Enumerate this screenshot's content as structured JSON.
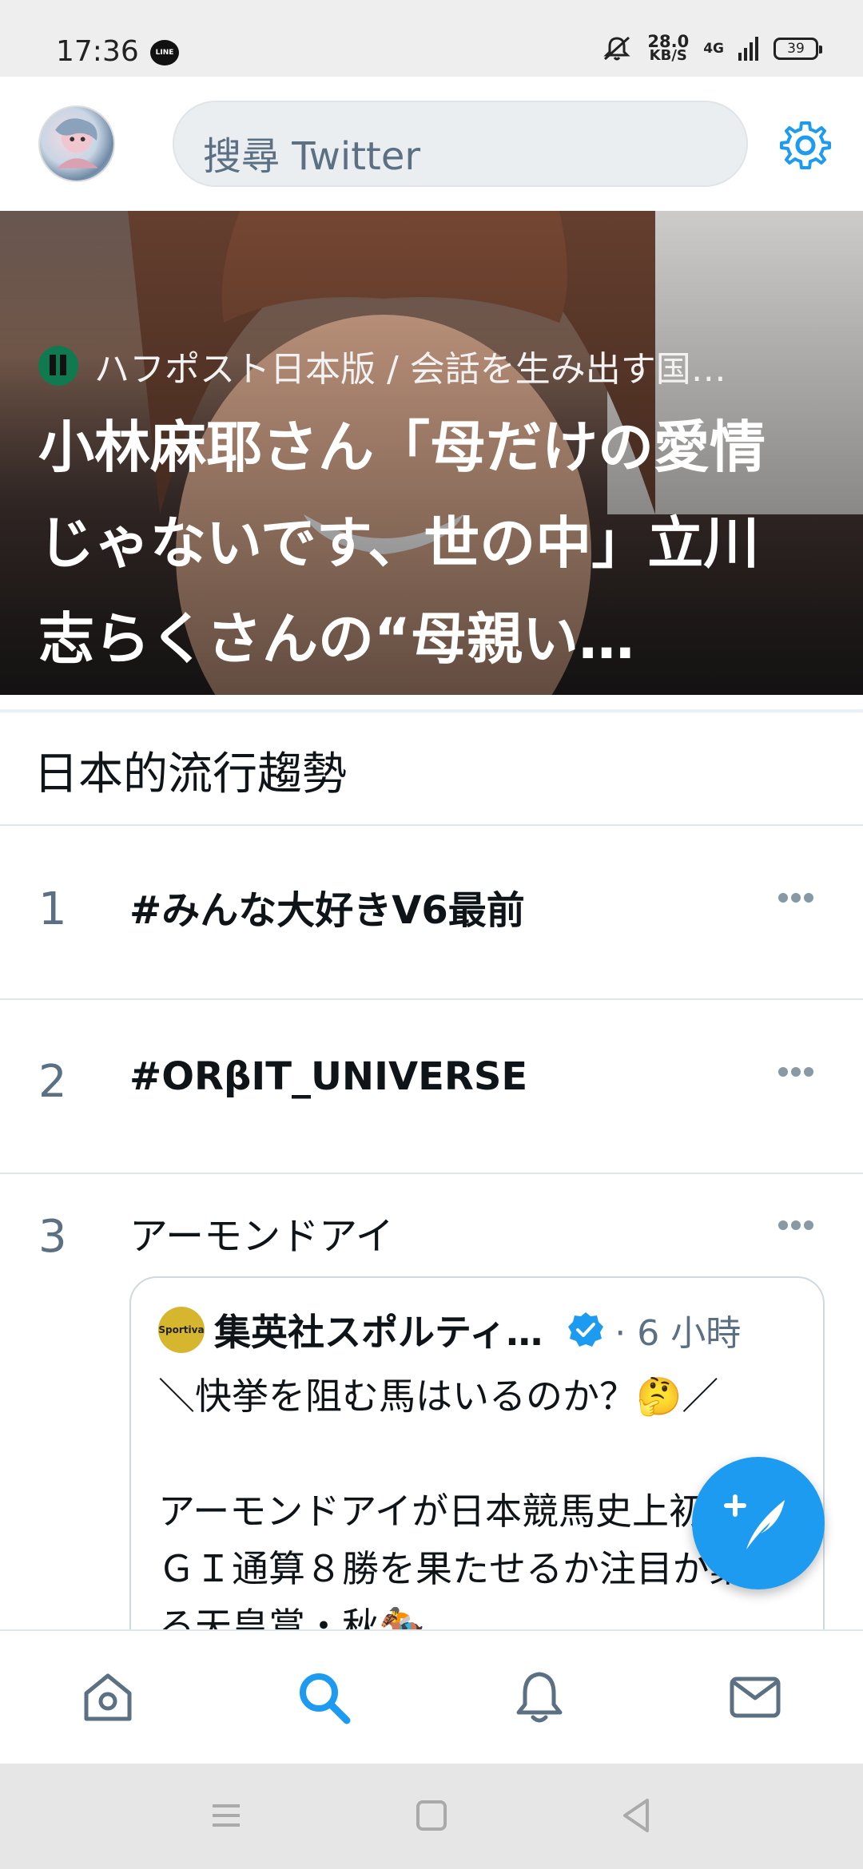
{
  "status_bar": {
    "time": "17:36",
    "app_icon": "LINE",
    "speed_value": "28.0",
    "speed_unit": "KB/S",
    "network": "4G",
    "battery": "39"
  },
  "header": {
    "search_placeholder": "搜尋 Twitter",
    "avatar_icon": "user-avatar",
    "settings_icon": "gear-icon"
  },
  "hero": {
    "source": "ハフポスト日本版 / 会話を生み出す国…",
    "headline": "小林麻耶さん「母だけの愛情じゃないです、世の中」立川志らくさんの“母親い…"
  },
  "trends": {
    "title": "日本的流行趨勢",
    "items": [
      {
        "rank": "1",
        "name": "#みんな大好きV6最前"
      },
      {
        "rank": "2",
        "name": "#ORβIT_UNIVERSE"
      },
      {
        "rank": "3",
        "name": "アーモンドアイ"
      }
    ]
  },
  "tweet_card": {
    "avatar_text": "Sportiva",
    "author": "集英社スポルティ…",
    "time": "· 6 小時",
    "text": "＼快挙を阻む馬はいるのか？🤔／\n\nアーモンドアイが日本競馬史上初の芝ＧＩ通算８勝を果たせるか注目が集まる天皇賞・秋🏇…"
  },
  "fab": {
    "icon": "compose-tweet-icon"
  },
  "bottom_nav": [
    "home-icon",
    "search-icon",
    "bell-icon",
    "mail-icon"
  ],
  "colors": {
    "accent": "#1d9bf0",
    "muted": "#5b7083",
    "divider": "#e1e8ed"
  }
}
